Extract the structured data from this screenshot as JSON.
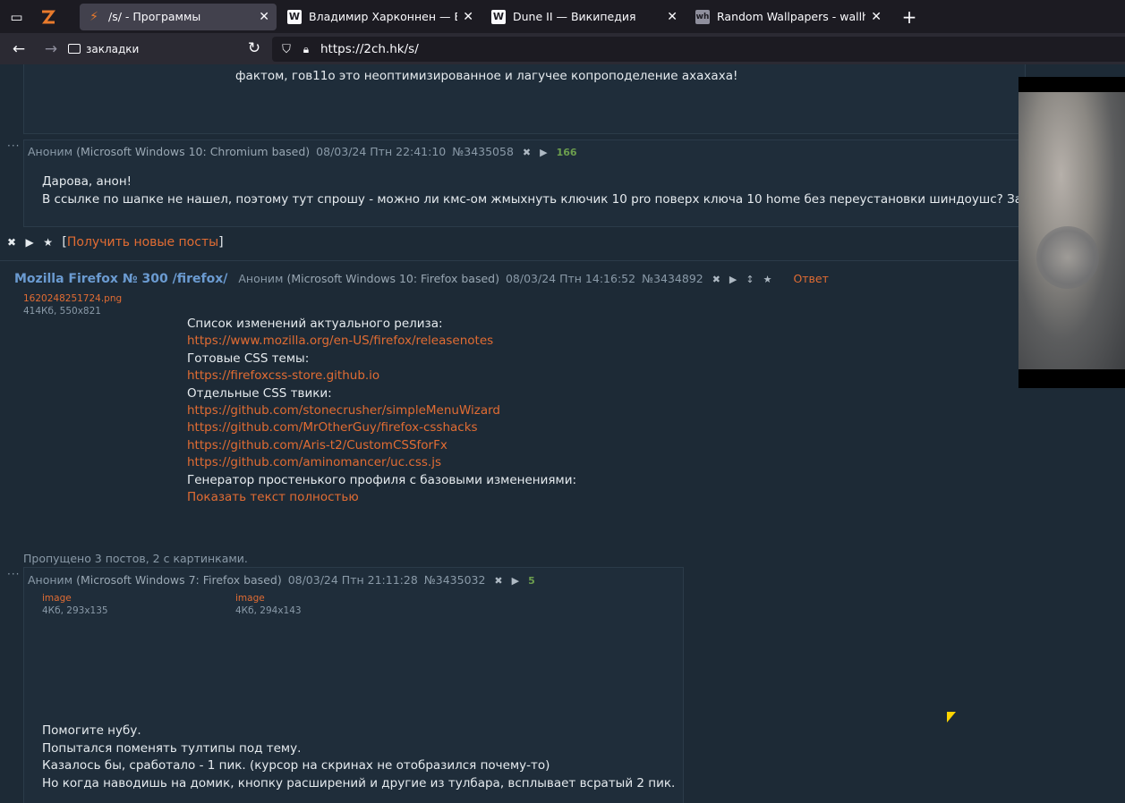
{
  "browser": {
    "tabs": [
      {
        "title": "/s/ - Программы",
        "active": true,
        "favicon": "bolt-icon"
      },
      {
        "title": "Владимир Харконнен — Википедия",
        "active": false,
        "favicon": "W"
      },
      {
        "title": "Dune II — Википедия",
        "active": false,
        "favicon": "W"
      },
      {
        "title": "Random Wallpapers - wallhaven",
        "active": false,
        "favicon": "wh"
      }
    ],
    "bookmarks_label": "закладки",
    "url": "https://2ch.hk/s/"
  },
  "post_top": {
    "text": "фактом, гов11о это неоптимизированное и лагучее копроподеление ахахаха!"
  },
  "post_a": {
    "author": "Аноним",
    "os": "(Microsoft Windows 10: Chromium based)",
    "date": "08/03/24 Птн 22:41:10",
    "number": "№3435058",
    "count": "166",
    "lines": [
      "Дарова, анон!",
      "В ссылке по шапке не нашел, поэтому тут спрошу - можно ли кмс-ом жмыхнуть ключик 10 pro поверх ключа 10 home без переустановки шиндоушс? Зарабо"
    ]
  },
  "thread_controls": {
    "get_new_open": "[",
    "get_new": "Получить новые посты",
    "get_new_close": "]"
  },
  "thread": {
    "title": "Mozilla Firefox № 300 /firefox/",
    "author": "Аноним",
    "os": "(Microsoft Windows 10: Firefox based)",
    "date": "08/03/24 Птн 14:16:52",
    "number": "№3434892",
    "answer": "Ответ",
    "file": {
      "name": "1620248251724.png",
      "size": "414Кб, 550x821"
    },
    "lines": [
      {
        "text": "Список изменений актуального релиза:",
        "link": false
      },
      {
        "text": "https://www.mozilla.org/en-US/firefox/releasenotes",
        "link": true
      },
      {
        "text": "Готовые CSS темы:",
        "link": false
      },
      {
        "text": "https://firefoxcss-store.github.io",
        "link": true
      },
      {
        "text": "Отдельные CSS твики:",
        "link": false
      },
      {
        "text": "https://github.com/stonecrusher/simpleMenuWizard",
        "link": true
      },
      {
        "text": "https://github.com/MrOtherGuy/firefox-csshacks",
        "link": true
      },
      {
        "text": "https://github.com/Aris-t2/CustomCSSforFx",
        "link": true
      },
      {
        "text": "https://github.com/aminomancer/uc.css.js",
        "link": true
      },
      {
        "text": "Генератор простенького профиля с базовыми изменениями:",
        "link": false
      },
      {
        "text": "Показать текст полностью",
        "link": true
      }
    ],
    "skipped": "Пропущено 3 постов, 2 с картинками."
  },
  "post_b": {
    "author": "Аноним",
    "os": "(Microsoft Windows 7: Firefox based)",
    "date": "08/03/24 Птн 21:11:28",
    "number": "№3435032",
    "count": "5",
    "files": [
      {
        "name": "image",
        "size": "4Кб, 293x135"
      },
      {
        "name": "image",
        "size": "4Кб, 294x143"
      }
    ],
    "lines": [
      "Помогите нубу.",
      "Попытался поменять тултипы под тему.",
      "Казалось бы, сработало - 1 пик. (курсор на скринах не отобразился почему-то)",
      "Но когда наводишь на домик, кнопку расширений и другие из тулбара, всплывает всратый 2 пик."
    ]
  },
  "colors": {
    "accent": "#e16c33",
    "title": "#6b9bd1",
    "bg": "#1d2a36",
    "count": "#6c9e4e"
  }
}
